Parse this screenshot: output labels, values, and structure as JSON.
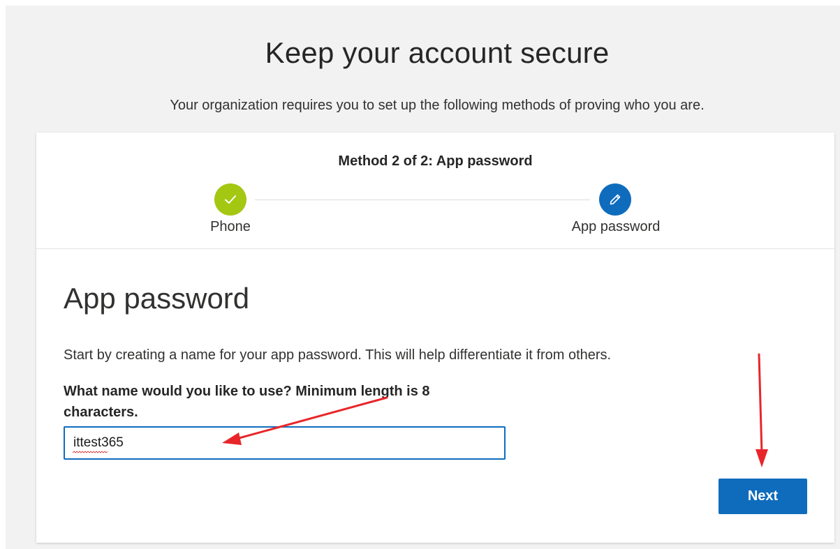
{
  "page": {
    "title": "Keep your account secure",
    "subtitle": "Your organization requires you to set up the following methods of proving who you are."
  },
  "progress": {
    "heading": "Method 2 of 2: App password",
    "steps": [
      {
        "label": "Phone",
        "status": "completed",
        "icon": "checkmark-icon",
        "color": "#a4c712"
      },
      {
        "label": "App password",
        "status": "current",
        "icon": "pencil-icon",
        "color": "#0f6cbd"
      }
    ]
  },
  "form": {
    "section_title": "App password",
    "instructions": "Start by creating a name for your app password. This will help differentiate it from others.",
    "field_label": "What name would you like to use? Minimum length is 8 characters.",
    "field_value": "ittest365",
    "next_label": "Next"
  },
  "annotations": {
    "arrow_color": "#e8262a",
    "arrows": [
      "points-to-name-input",
      "points-to-next-button"
    ]
  },
  "colors": {
    "accent": "#0f6cbd",
    "success": "#a4c712",
    "background": "#f2f2f2"
  }
}
